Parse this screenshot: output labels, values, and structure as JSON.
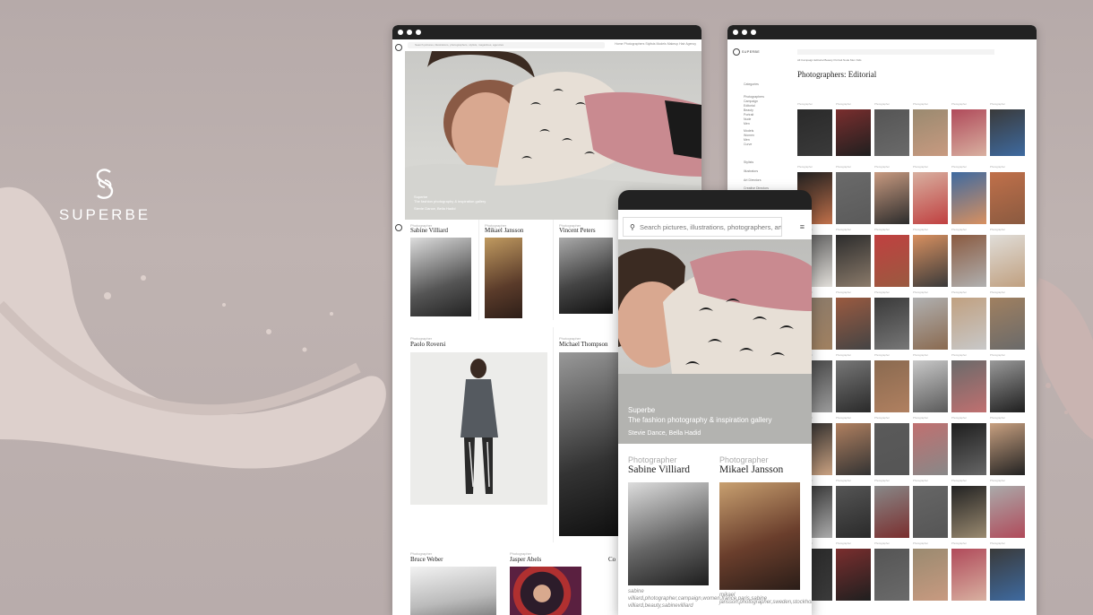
{
  "brand": {
    "name": "SUPERBE",
    "logo_icon": "s-monogram-icon"
  },
  "desktop_window": {
    "search_placeholder": "Search pictures, illustrations, photographers, stylists, magazines, agencies",
    "nav": "Home  Photographers  Stylists  Models  Makeup  Hair  Agency",
    "hero_caption": [
      "Superbe",
      "The fashion photography & inspiration gallery",
      "Stevie Dance, Bella Hadid"
    ],
    "photographers": [
      {
        "role": "Photographer",
        "name": "Sabine Villiard"
      },
      {
        "role": "Photographer",
        "name": "Mikael Jansson"
      },
      {
        "role": "Photographer",
        "name": "Vincent Peters"
      },
      {
        "role": "Photographer",
        "name": "Paolo Roversi"
      },
      {
        "role": "Photographer",
        "name": "Michael Thompson"
      },
      {
        "role": "Photographer",
        "name": "Bruce Weber"
      },
      {
        "role": "Photographer",
        "name": "Jasper Abels"
      },
      {
        "role": "Photographer",
        "name": "Co"
      }
    ]
  },
  "editorial_window": {
    "title": "Photographers: Editorial",
    "tabs": "All  Campaign  Editorial  Beauty  Portrait  Nude  Men  Kids",
    "sidebar": [
      "Categories",
      "Photographers",
      "Campaign",
      "Editorial",
      "Beauty",
      "Portrait",
      "Nude",
      "Men",
      "Models",
      "Women",
      "Men",
      "Curve",
      "Stylists",
      "Illustrators",
      "Art Directors",
      "Creative Directors",
      "Influencers"
    ],
    "thumb_label": "Photographer"
  },
  "phone": {
    "search_placeholder": "Search pictures, illustrations, photographers, artists",
    "menu_icon": "hamburger-icon",
    "hero_caption": {
      "line1": "Superbe",
      "line2": "The fashion photography & inspiration gallery",
      "line3": "Stevie Dance, Bella Hadid"
    },
    "cards": [
      {
        "role": "Photographer",
        "name": "Sabine Villiard",
        "tags": "sabine villiard,photographer,campaign,women,france,paris,sabine villiard,beauty,sabinevilliard"
      },
      {
        "role": "Photographer",
        "name": "Mikael Jansson",
        "tags": "mikael jansson,photographer,sweden,stockholm,editorial,mixed"
      }
    ]
  }
}
